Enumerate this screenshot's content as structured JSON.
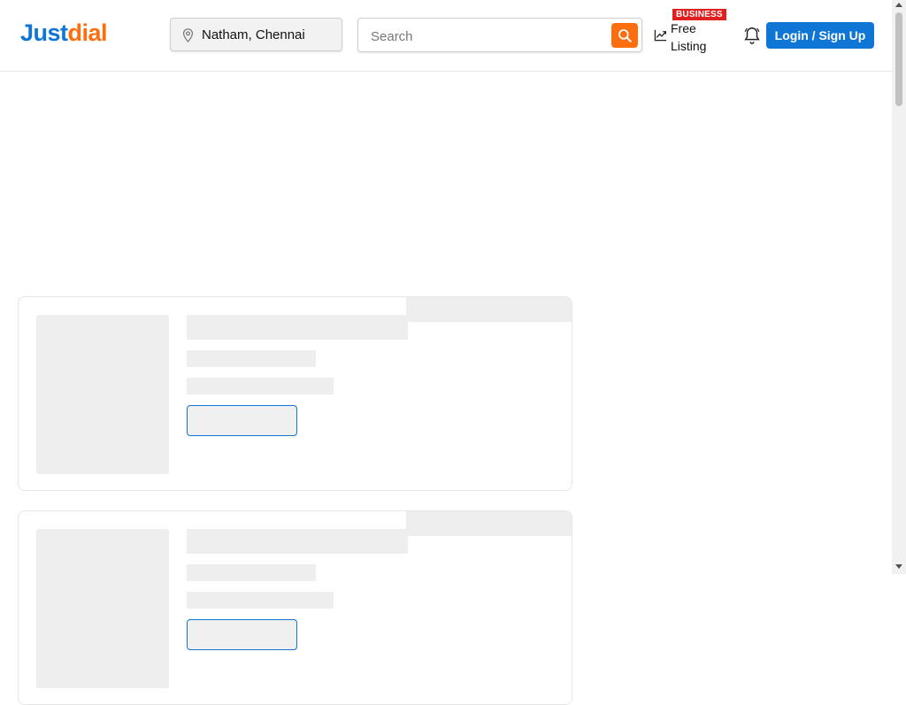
{
  "header": {
    "logo": {
      "part1": "Just",
      "part2": "dial"
    },
    "location": {
      "icon": "location-pin-icon",
      "text": "Natham, Chennai"
    },
    "search": {
      "placeholder": "Search",
      "icon": "search-icon"
    },
    "free_listing": {
      "badge": "BUSINESS",
      "label": "Free Listing",
      "icon": "trending-up-icon"
    },
    "notification": {
      "icon": "bell-icon"
    },
    "login_label": "Login / Sign Up"
  },
  "colors": {
    "brand_blue": "#0f76d6",
    "brand_orange": "#ff6e0e",
    "badge_red": "#e0201e",
    "skeleton": "#eeeeee"
  },
  "listing_placeholders": [
    {
      "state": "loading"
    },
    {
      "state": "loading"
    }
  ]
}
